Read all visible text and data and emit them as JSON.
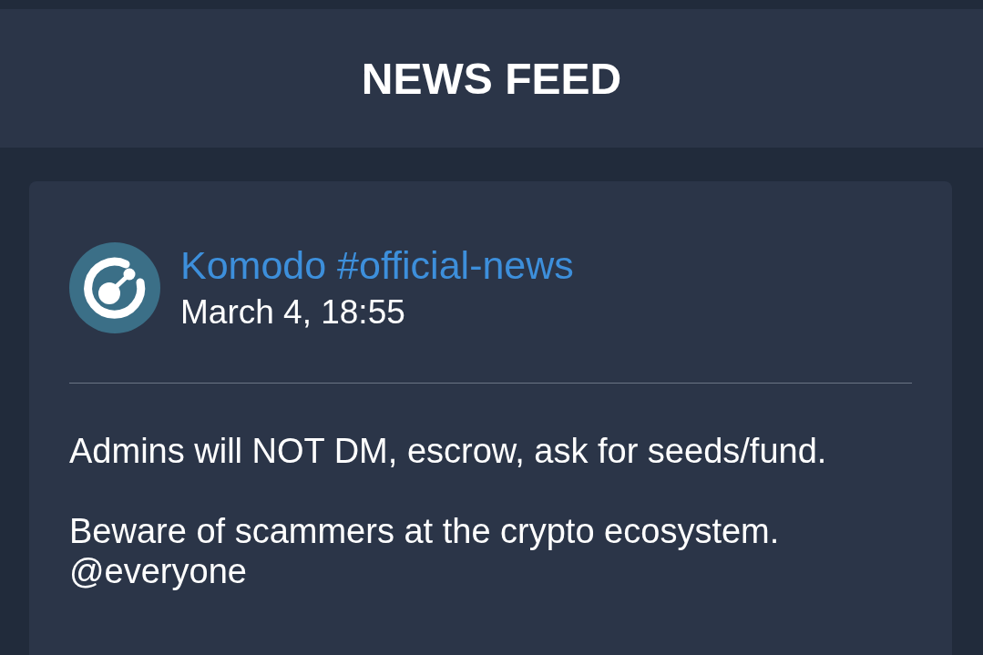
{
  "header": {
    "title": "NEWS FEED"
  },
  "posts": [
    {
      "channel": "Komodo #official-news",
      "date": "March 4, 18:55",
      "paragraphs": [
        {
          "lines": [
            "Admins will NOT DM, escrow, ask for seeds/fund."
          ]
        },
        {
          "lines": [
            "Beware of scammers at the crypto ecosystem.",
            "@everyone"
          ]
        }
      ]
    }
  ]
}
